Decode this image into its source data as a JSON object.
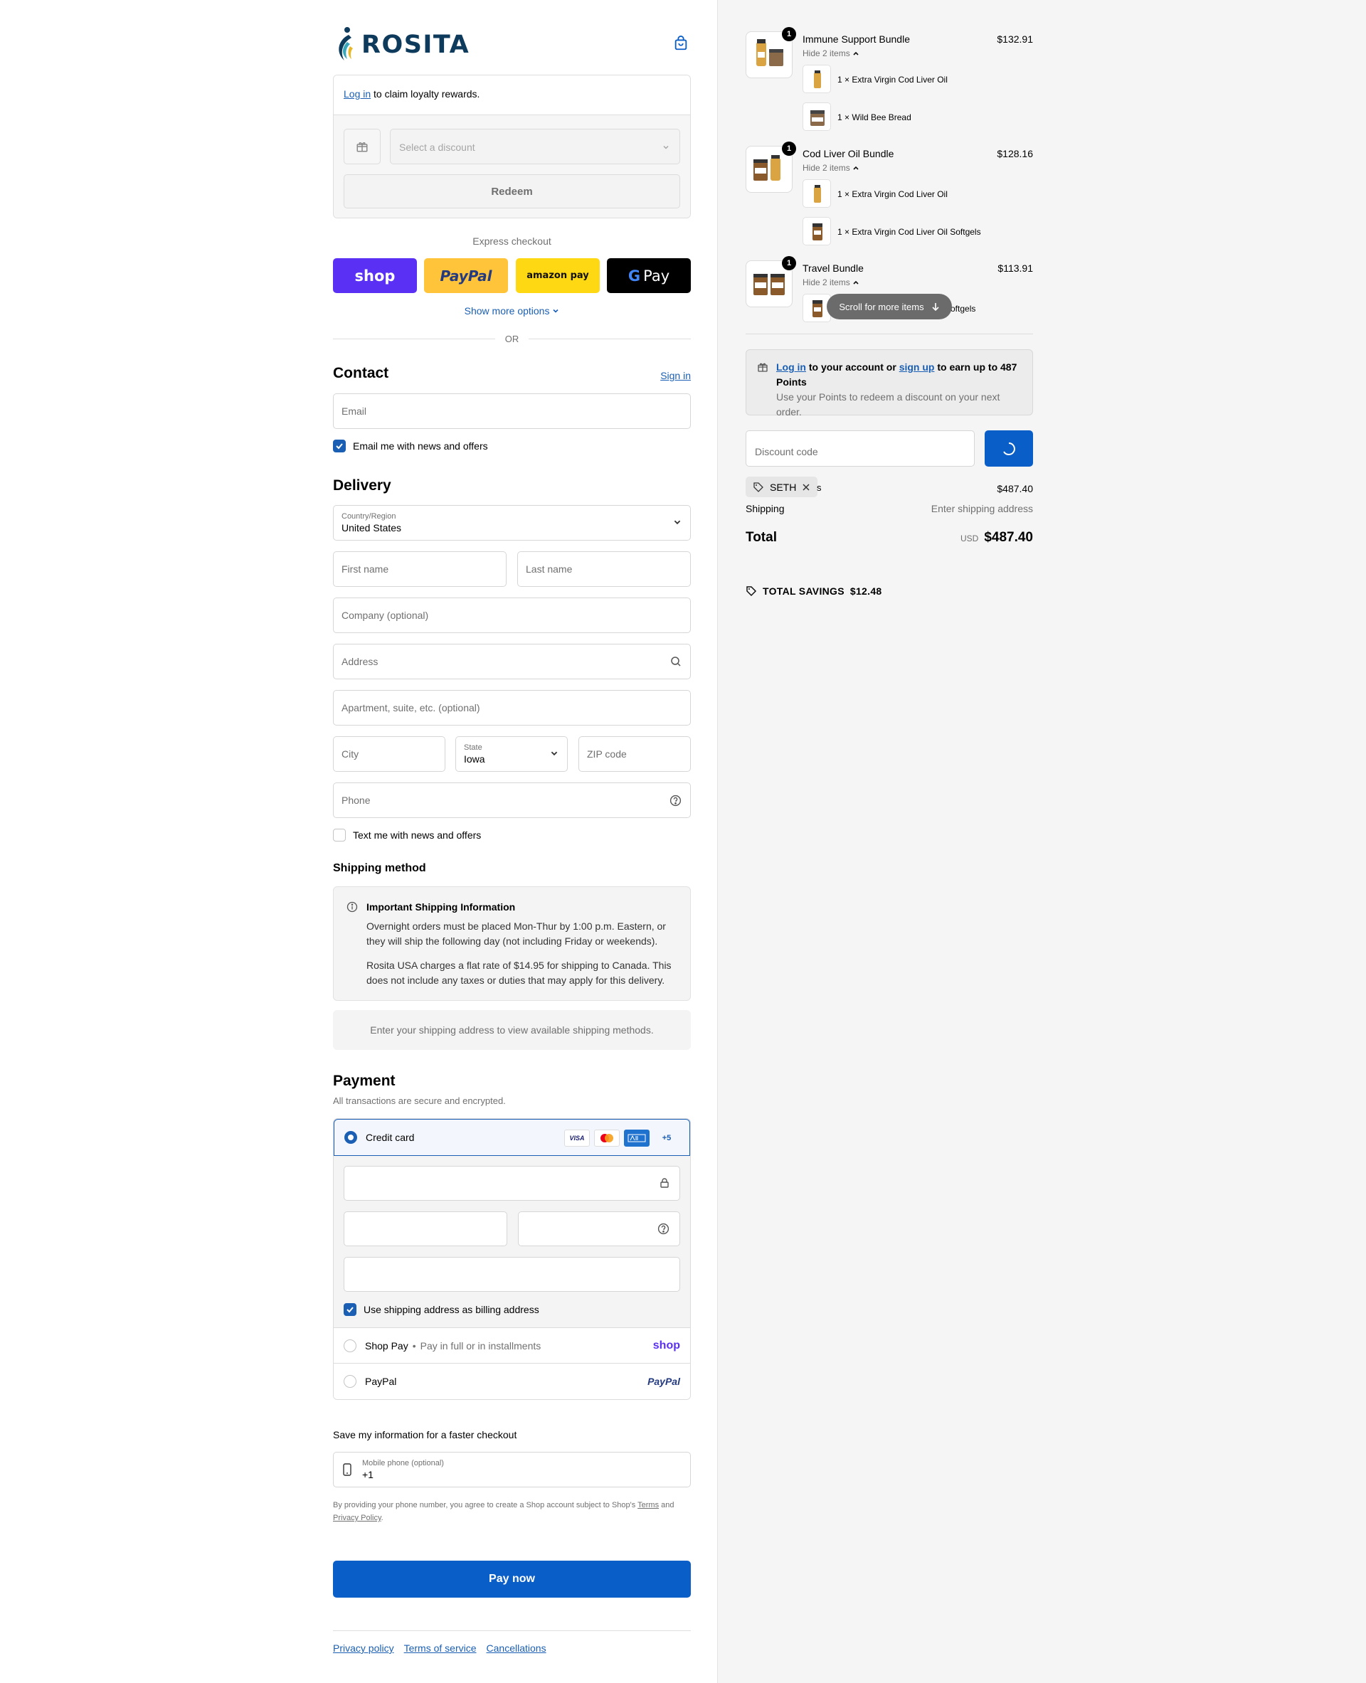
{
  "brand": {
    "name": "ROSITA",
    "accent": "#0a5ec7",
    "logo_color": "#0e3a5c"
  },
  "loyalty": {
    "login_link": "Log in",
    "login_text": " to claim loyalty rewards.",
    "select_placeholder": "Select a discount",
    "redeem_label": "Redeem"
  },
  "express": {
    "label": "Express checkout",
    "shop": "shop",
    "paypal": "PayPal",
    "amazon": "amazon pay",
    "gpay": "Pay",
    "show_more": "Show more options",
    "or": "OR"
  },
  "contact": {
    "title": "Contact",
    "sign_in": "Sign in",
    "email_placeholder": "Email",
    "news_checkbox": "Email me with news and offers",
    "news_checked": true
  },
  "delivery": {
    "title": "Delivery",
    "country_label": "Country/Region",
    "country_value": "United States",
    "first_name": "First name",
    "last_name": "Last name",
    "company": "Company (optional)",
    "address": "Address",
    "apartment": "Apartment, suite, etc. (optional)",
    "city": "City",
    "state_label": "State",
    "state_value": "Iowa",
    "zip": "ZIP code",
    "phone": "Phone",
    "text_checkbox": "Text me with news and offers",
    "text_checked": false
  },
  "shipping": {
    "title": "Shipping method",
    "info_title": "Important Shipping Information",
    "info_p1": "Overnight orders must be placed Mon-Thur by 1:00 p.m. Eastern, or they will ship the following day (not including Friday or weekends).",
    "info_p2": "Rosita USA charges a flat rate of $14.95 for shipping to Canada. This does not include any taxes or duties that may apply for this delivery.",
    "empty_text": "Enter your shipping address to view available shipping methods."
  },
  "payment": {
    "title": "Payment",
    "subtitle": "All transactions are secure and encrypted.",
    "credit_card": "Credit card",
    "card_visa": "VISA",
    "card_more": "+5",
    "billing_checkbox": "Use shipping address as billing address",
    "billing_checked": true,
    "shop_pay": "Shop Pay",
    "shop_pay_dot": "•",
    "shop_pay_sub": "Pay in full or in installments",
    "shop_pay_brand": "shop",
    "paypal": "PayPal",
    "paypal_brand": "PayPal"
  },
  "save_info": {
    "title": "Save my information for a faster checkout",
    "mobile_label": "Mobile phone (optional)",
    "mobile_value": "+1",
    "legal_prefix": "By providing your phone number, you agree to create a Shop account subject to Shop's ",
    "terms": "Terms",
    "and": " and ",
    "privacy": "Privacy Policy",
    "end": "."
  },
  "pay_now": "Pay now",
  "footer": {
    "privacy": "Privacy policy",
    "terms": "Terms of service",
    "cancellations": "Cancellations"
  },
  "order": {
    "items": [
      {
        "name": "Immune Support Bundle",
        "price": "$132.91",
        "qty": "1",
        "hide": "Hide 2 items",
        "sub": [
          {
            "qty": "1",
            "x": "×",
            "name": "Extra Virgin Cod Liver Oil"
          },
          {
            "qty": "1",
            "x": "×",
            "name": "Wild Bee Bread"
          }
        ]
      },
      {
        "name": "Cod Liver Oil Bundle",
        "price": "$128.16",
        "qty": "1",
        "hide": "Hide 2 items",
        "sub": [
          {
            "qty": "1",
            "x": "×",
            "name": "Extra Virgin Cod Liver Oil"
          },
          {
            "qty": "1",
            "x": "×",
            "name": "Extra Virgin Cod Liver Oil Softgels"
          }
        ]
      },
      {
        "name": "Travel Bundle",
        "price": "$113.91",
        "qty": "1",
        "hide": "Hide 2 items",
        "sub": [
          {
            "name": "oftgels"
          }
        ]
      }
    ],
    "scroll_hint": "Scroll for more items",
    "points": {
      "login": "Log in",
      "mid1": " to your account or ",
      "signup": "sign up",
      "mid2": " to earn up to 487 Points",
      "sub": "Use your Points to redeem a discount on your next order."
    },
    "discount_placeholder": "Discount code",
    "tag": "SETH",
    "tag_overflow": "s",
    "subtotal_value": "$487.40",
    "shipping_label": "Shipping",
    "shipping_value": "Enter shipping address",
    "total_label": "Total",
    "total_currency": "USD",
    "total_value": "$487.40",
    "savings_label": "TOTAL SAVINGS",
    "savings_value": "$12.48"
  }
}
